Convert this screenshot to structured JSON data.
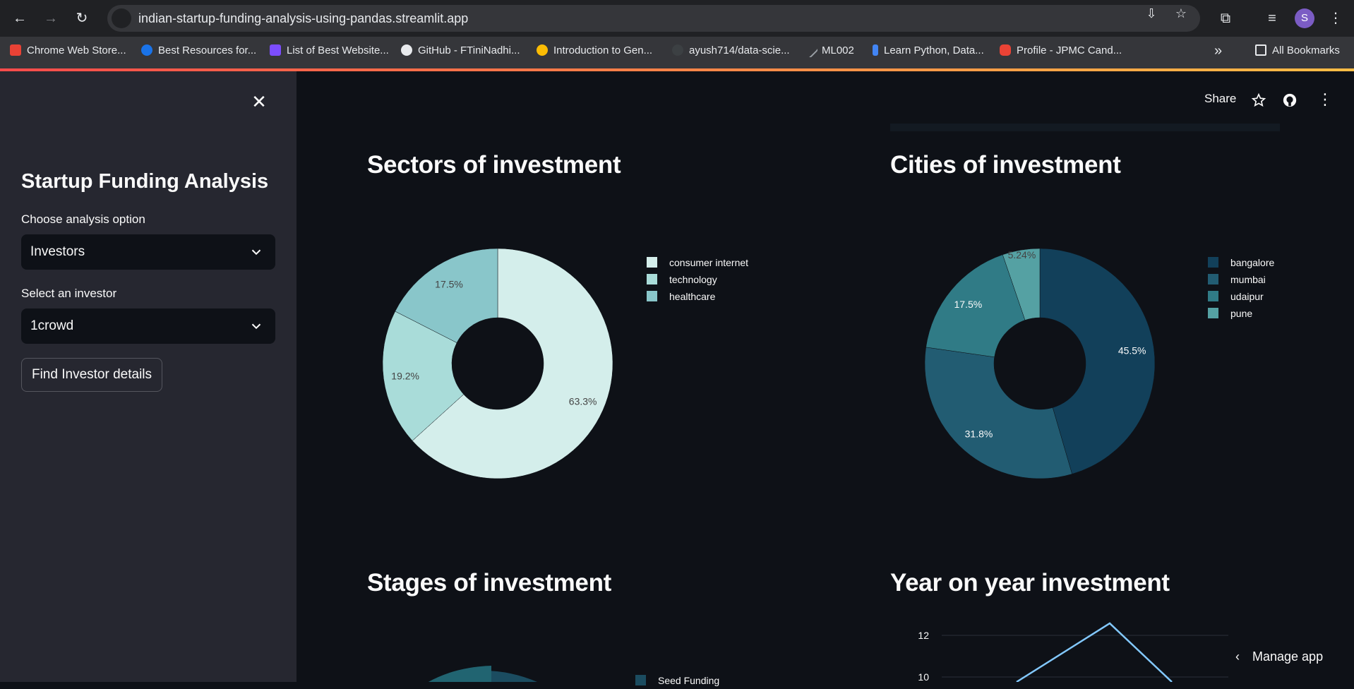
{
  "browser": {
    "url": "indian-startup-funding-analysis-using-pandas.streamlit.app",
    "avatar_letter": "S",
    "bookmarks": [
      {
        "label": "Chrome Web Store...",
        "color": "#e94235"
      },
      {
        "label": "Best Resources for...",
        "color": "#1a73e8"
      },
      {
        "label": "List of Best Website...",
        "color": "#7c4dff"
      },
      {
        "label": "GitHub - FTiniNadhi...",
        "color": "#e8eaed"
      },
      {
        "label": "Introduction to Gen...",
        "color": "#fbbc04"
      },
      {
        "label": "ayush714/data-scie...",
        "color": "#3c4043"
      },
      {
        "label": "ML002",
        "color": "#9aa0a6"
      },
      {
        "label": "Learn Python, Data...",
        "color": "#4285f4"
      },
      {
        "label": "Profile - JPMC Cand...",
        "color": "#ea4335"
      }
    ],
    "all_bookmarks": "All Bookmarks",
    "more": "»"
  },
  "sidebar": {
    "title": "Startup Funding Analysis",
    "analysis_label": "Choose analysis option",
    "analysis_value": "Investors",
    "investor_label": "Select an investor",
    "investor_value": "1crowd",
    "button_label": "Find Investor details"
  },
  "header": {
    "share": "Share"
  },
  "manage_app": "Manage app",
  "chart_data": [
    {
      "type": "pie",
      "title": "Sectors of investment",
      "labels": [
        "consumer internet",
        "technology",
        "healthcare"
      ],
      "values": [
        63.3,
        19.2,
        17.5
      ],
      "value_labels": [
        "63.3%",
        "19.2%",
        "17.5%"
      ],
      "colors": [
        "#d4eeeb",
        "#a9dcd9",
        "#89c6ca"
      ],
      "legend_colors": [
        "#d4eeeb",
        "#a9dcd9",
        "#89c6ca"
      ],
      "hole": true
    },
    {
      "type": "pie",
      "title": "Cities of investment",
      "labels": [
        "bangalore",
        "mumbai",
        "udaipur",
        "pune"
      ],
      "values": [
        45.5,
        31.8,
        17.5,
        5.24
      ],
      "value_labels": [
        "45.5%",
        "31.8%",
        "17.5%",
        "5.24%"
      ],
      "colors": [
        "#12405a",
        "#225c72",
        "#307b86",
        "#55a1a3"
      ],
      "hole": true
    },
    {
      "type": "pie",
      "title": "Stages of investment",
      "labels": [
        "Seed Funding"
      ],
      "colors": [
        "#1b4c60"
      ],
      "hole": true
    },
    {
      "type": "line",
      "title": "Year on year investment",
      "y_ticks": [
        "12",
        "10"
      ],
      "color": "#83c9ff"
    }
  ]
}
